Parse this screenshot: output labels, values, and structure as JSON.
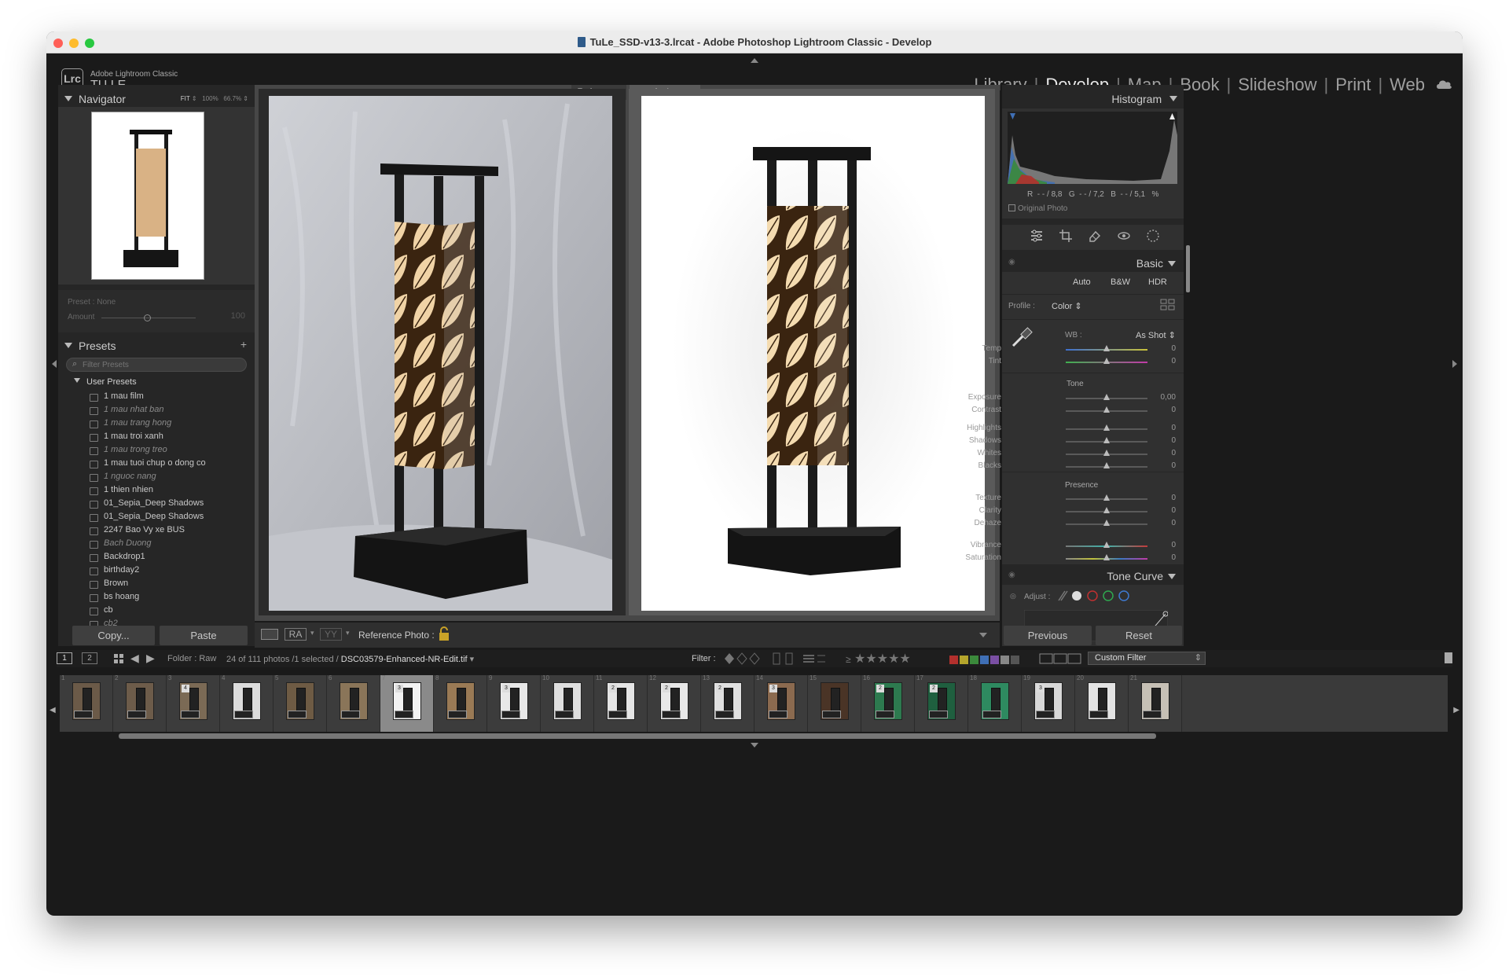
{
  "window": {
    "title": "TuLe_SSD-v13-3.lrcat - Adobe Photoshop Lightroom Classic - Develop"
  },
  "identity": {
    "logo": "Lrc",
    "app_name": "Adobe Lightroom Classic",
    "user": "TU LE"
  },
  "modules": {
    "items": [
      "Library",
      "Develop",
      "Map",
      "Book",
      "Slideshow",
      "Print",
      "Web"
    ],
    "active": "Develop",
    "cloud_icon": "cloud-icon"
  },
  "navigator": {
    "title": "Navigator",
    "zoom_options": [
      "FIT",
      "100%",
      "66.7%"
    ]
  },
  "quick_preset": {
    "label": "Preset : None",
    "amount_label": "Amount",
    "amount_value": "100"
  },
  "presets": {
    "title": "Presets",
    "filter_placeholder": "Filter Presets",
    "group": "User Presets",
    "items": [
      {
        "name": "1 mau film",
        "italic": false
      },
      {
        "name": "1 mau nhat ban",
        "italic": true
      },
      {
        "name": "1 mau trang hong",
        "italic": true
      },
      {
        "name": "1 mau troi xanh",
        "italic": false
      },
      {
        "name": "1 mau trong treo",
        "italic": true
      },
      {
        "name": "1 mau tuoi chup o dong co",
        "italic": false
      },
      {
        "name": "1 nguoc nang",
        "italic": true
      },
      {
        "name": "1 thien nhien",
        "italic": false
      },
      {
        "name": "01_Sepia_Deep Shadows",
        "italic": false
      },
      {
        "name": "01_Sepia_Deep Shadows",
        "italic": false
      },
      {
        "name": "2247 Bao Vy xe BUS",
        "italic": false
      },
      {
        "name": "Bach Duong",
        "italic": true
      },
      {
        "name": "Backdrop1",
        "italic": false
      },
      {
        "name": "birthday2",
        "italic": false
      },
      {
        "name": "Brown",
        "italic": false
      },
      {
        "name": "bs hoang",
        "italic": false
      },
      {
        "name": "cb",
        "italic": false
      },
      {
        "name": "cb2",
        "italic": true
      }
    ]
  },
  "left_buttons": {
    "copy": "Copy...",
    "paste": "Paste"
  },
  "compare": {
    "reference_label": "Reference",
    "active_label": "Active"
  },
  "toolbar": {
    "view_ra": "RA",
    "view_yy": "YY",
    "reference_photo_label": "Reference Photo :"
  },
  "histogram": {
    "title": "Histogram",
    "r_label": "R",
    "r_value": "- - / 8,8",
    "g_label": "G",
    "g_value": "- - / 7,2",
    "b_label": "B",
    "b_value": "- - / 5,1",
    "pct": "%",
    "original_photo": "Original Photo"
  },
  "basic": {
    "title": "Basic",
    "treatment_buttons": [
      "Auto",
      "B&W",
      "HDR"
    ],
    "profile_label": "Profile :",
    "profile_value": "Color",
    "wb_label": "WB :",
    "wb_value": "As Shot",
    "sliders_wb": [
      {
        "label": "Temp",
        "value": "0"
      },
      {
        "label": "Tint",
        "value": "0"
      }
    ],
    "tone_header": "Tone",
    "sliders_tone": [
      {
        "label": "Exposure",
        "value": "0,00"
      },
      {
        "label": "Contrast",
        "value": "0"
      },
      {
        "label": "Highlights",
        "value": "0"
      },
      {
        "label": "Shadows",
        "value": "0"
      },
      {
        "label": "Whites",
        "value": "0"
      },
      {
        "label": "Blacks",
        "value": "0"
      }
    ],
    "presence_header": "Presence",
    "sliders_presence": [
      {
        "label": "Texture",
        "value": "0"
      },
      {
        "label": "Clarity",
        "value": "0"
      },
      {
        "label": "Dehaze",
        "value": "0"
      },
      {
        "label": "Vibrance",
        "value": "0"
      },
      {
        "label": "Saturation",
        "value": "0"
      }
    ]
  },
  "tone_curve": {
    "title": "Tone Curve",
    "adjust_label": "Adjust :"
  },
  "right_buttons": {
    "previous": "Previous",
    "reset": "Reset"
  },
  "filmstrip_bar": {
    "screen1": "1",
    "screen2": "2",
    "folder_label": "Folder : Raw",
    "count_text": "24 of 111 photos /1 selected /",
    "filename": "DSC03579-Enhanced-NR-Edit.tif",
    "filter_label": "Filter :",
    "custom_filter": "Custom Filter",
    "label_colors": [
      "#b3302d",
      "#b5a52c",
      "#3b8a3b",
      "#3f6fb5",
      "#7a4fa3",
      "#888888",
      "#555555"
    ]
  },
  "filmstrip": {
    "thumbs": [
      {
        "num": "1",
        "badge": "",
        "tone": "#6b5a48",
        "selected": false
      },
      {
        "num": "2",
        "badge": "",
        "tone": "#6d5c4a",
        "selected": false
      },
      {
        "num": "3",
        "badge": "4",
        "tone": "#7b6a55",
        "selected": false
      },
      {
        "num": "4",
        "badge": "",
        "tone": "#dcdcdc",
        "selected": false
      },
      {
        "num": "5",
        "badge": "",
        "tone": "#6e5b44",
        "selected": false
      },
      {
        "num": "6",
        "badge": "",
        "tone": "#8a7559",
        "selected": false
      },
      {
        "num": "7",
        "badge": "3",
        "tone": "#f2f2f2",
        "selected": true
      },
      {
        "num": "8",
        "badge": "",
        "tone": "#9a7a55",
        "selected": false
      },
      {
        "num": "9",
        "badge": "3",
        "tone": "#e8e8e8",
        "selected": false
      },
      {
        "num": "10",
        "badge": "",
        "tone": "#dedede",
        "selected": false
      },
      {
        "num": "11",
        "badge": "2",
        "tone": "#e5e5e5",
        "selected": false
      },
      {
        "num": "12",
        "badge": "2",
        "tone": "#e8e8e8",
        "selected": false
      },
      {
        "num": "13",
        "badge": "2",
        "tone": "#e0e0e0",
        "selected": false
      },
      {
        "num": "14",
        "badge": "3",
        "tone": "#8b6a4f",
        "selected": false
      },
      {
        "num": "15",
        "badge": "",
        "tone": "#4a3426",
        "selected": false
      },
      {
        "num": "16",
        "badge": "2",
        "tone": "#2d7a4f",
        "selected": false
      },
      {
        "num": "17",
        "badge": "2",
        "tone": "#1f5f3f",
        "selected": false
      },
      {
        "num": "18",
        "badge": "",
        "tone": "#2e8a60",
        "selected": false
      },
      {
        "num": "19",
        "badge": "3",
        "tone": "#d8d8d8",
        "selected": false
      },
      {
        "num": "20",
        "badge": "",
        "tone": "#e3e3e3",
        "selected": false
      },
      {
        "num": "21",
        "badge": "",
        "tone": "#c6c0b5",
        "selected": false
      }
    ]
  }
}
